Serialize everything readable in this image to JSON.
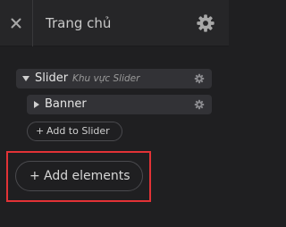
{
  "header": {
    "close_icon": "close-icon",
    "title": "Trang chủ",
    "settings_icon": "gear-icon"
  },
  "tree": {
    "slider": {
      "label": "Slider",
      "sublabel": "Khu vực Slider",
      "expanded": true,
      "settings_icon": "gear-icon"
    },
    "banner": {
      "label": "Banner",
      "expanded": false,
      "settings_icon": "gear-icon"
    },
    "add_to_slider": {
      "plus": "+",
      "label": "Add to Slider"
    }
  },
  "add_elements": {
    "plus": "+",
    "label": "Add elements"
  },
  "colors": {
    "background": "#1f1f21",
    "header": "#262628",
    "row": "#323236",
    "highlight": "#e23236"
  }
}
